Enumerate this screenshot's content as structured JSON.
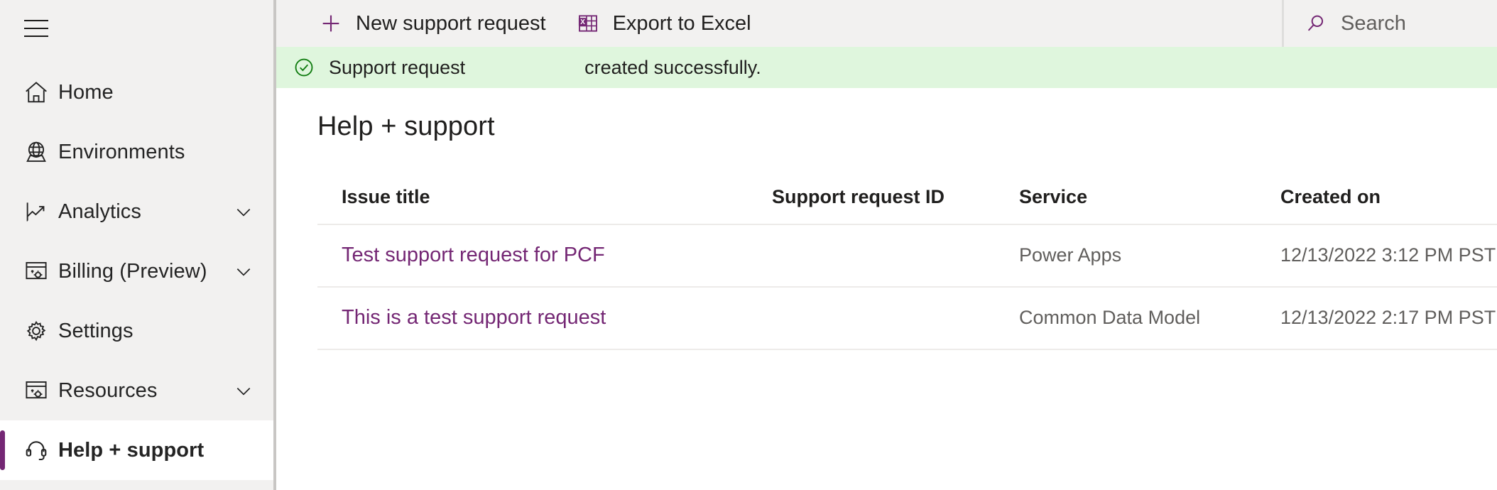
{
  "sidebar": {
    "menu_button": "menu-toggle",
    "items": [
      {
        "label": "Home",
        "icon": "home-icon",
        "expandable": false,
        "selected": false
      },
      {
        "label": "Environments",
        "icon": "globe-icon",
        "expandable": false,
        "selected": false
      },
      {
        "label": "Analytics",
        "icon": "chart-icon",
        "expandable": true,
        "selected": false
      },
      {
        "label": "Billing (Preview)",
        "icon": "billing-icon",
        "expandable": true,
        "selected": false
      },
      {
        "label": "Settings",
        "icon": "gear-icon",
        "expandable": false,
        "selected": false
      },
      {
        "label": "Resources",
        "icon": "resources-icon",
        "expandable": true,
        "selected": false
      },
      {
        "label": "Help + support",
        "icon": "headset-icon",
        "expandable": false,
        "selected": true
      }
    ]
  },
  "commandbar": {
    "new_request_label": "New support request",
    "export_excel_label": "Export to Excel"
  },
  "search": {
    "placeholder": "Search",
    "value": ""
  },
  "banner": {
    "status": "success",
    "text_before": "Support request",
    "request_id": "",
    "text_after": "created successfully."
  },
  "page": {
    "title": "Help + support"
  },
  "table": {
    "columns": [
      "Issue title",
      "Support request ID",
      "Service",
      "Created on"
    ],
    "rows": [
      {
        "issue_title": "Test support request for PCF",
        "support_request_id": "",
        "service": "Power Apps",
        "created_on": "12/13/2022 3:12 PM PST"
      },
      {
        "issue_title": "This is a test support request",
        "support_request_id": "",
        "service": "Common Data Model",
        "created_on": "12/13/2022 2:17 PM PST"
      }
    ]
  },
  "colors": {
    "accent_purple": "#742774",
    "sidebar_bg": "#f2f1f0",
    "banner_bg": "#dff6dd",
    "banner_icon": "#107c10",
    "text_primary": "#201f1e",
    "text_secondary": "#605e5c",
    "divider": "#edebe9"
  }
}
